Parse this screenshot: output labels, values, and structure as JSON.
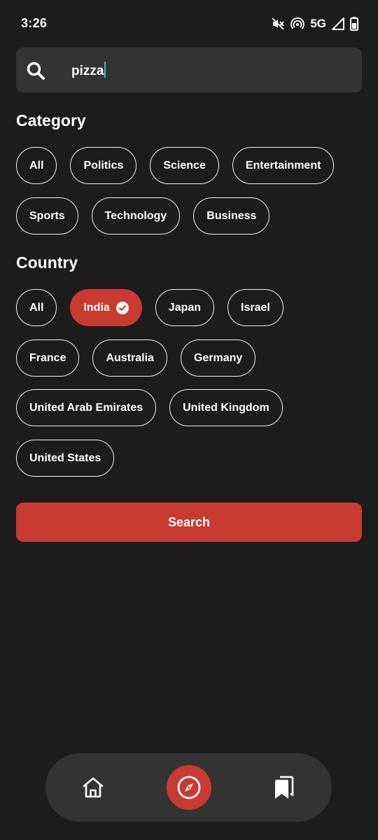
{
  "status_bar": {
    "time": "3:26",
    "network": "5G",
    "icons": [
      "mute-icon",
      "hotspot-icon",
      "signal-icon",
      "battery-icon"
    ]
  },
  "search": {
    "value": "pizza",
    "icon": "search-icon"
  },
  "category": {
    "title": "Category",
    "chips": [
      "All",
      "Politics",
      "Science",
      "Entertainment",
      "Sports",
      "Technology",
      "Business"
    ]
  },
  "country": {
    "title": "Country",
    "selected": "India",
    "chips": [
      "All",
      "India",
      "Japan",
      "Israel",
      "France",
      "Australia",
      "Germany",
      "United Arab Emirates",
      "United Kingdom",
      "United States"
    ]
  },
  "search_button": {
    "label": "Search"
  },
  "bottom_nav": {
    "items": [
      {
        "name": "home",
        "icon": "home-icon"
      },
      {
        "name": "explore",
        "icon": "compass-icon",
        "active": true
      },
      {
        "name": "saved",
        "icon": "bookmarks-icon"
      }
    ]
  },
  "colors": {
    "background": "#1c1c1c",
    "surface": "#333333",
    "accent": "#c93a31",
    "caret": "#2ec4c4"
  }
}
